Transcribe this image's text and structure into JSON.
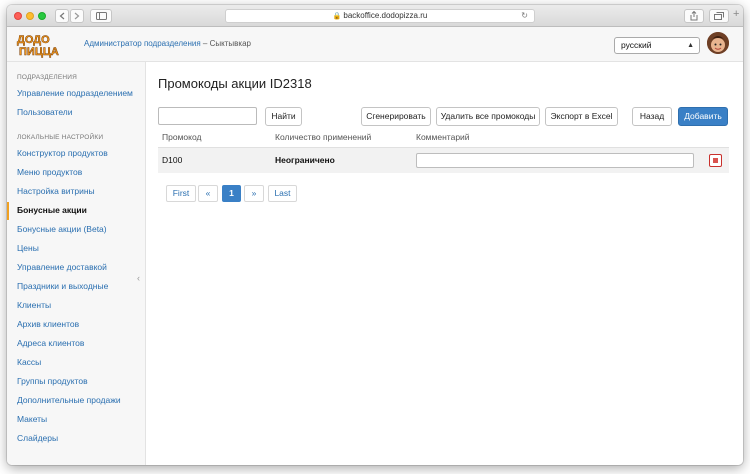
{
  "browser": {
    "url": "backoffice.dodopizza.ru",
    "new_tab": "+"
  },
  "header": {
    "logo_alt": "ДОДО ПИЦЦА",
    "role": "Администратор подразделения",
    "separator": " – ",
    "city": "Сыктывкар",
    "language": "русский"
  },
  "sidebar": {
    "section1": "ПОДРАЗДЕЛЕНИЯ",
    "items1": [
      "Управление подразделением",
      "Пользователи"
    ],
    "section2": "ЛОКАЛЬНЫЕ НАСТРОЙКИ",
    "items2": [
      "Конструктор продуктов",
      "Меню продуктов",
      "Настройка витрины",
      "Бонусные акции",
      "Бонусные акции (Beta)",
      "Цены",
      "Управление доставкой",
      "Праздники и выходные",
      "Клиенты",
      "Архив клиентов",
      "Адреса клиентов",
      "Кассы",
      "Группы продуктов",
      "Дополнительные продажи",
      "Макеты",
      "Слайдеры"
    ],
    "active_item": "Бонусные акции"
  },
  "main": {
    "title": "Промокоды акции ID2318",
    "search": {
      "value": "",
      "placeholder": ""
    },
    "buttons": {
      "find": "Найти",
      "generate": "Сгенерировать",
      "delete_all": "Удалить все промокоды",
      "export": "Экспорт в Excel",
      "back": "Назад",
      "add": "Добавить"
    },
    "table": {
      "columns": [
        "Промокод",
        "Количество применений",
        "Комментарий"
      ],
      "rows": [
        {
          "code": "D100",
          "uses": "Неограничено",
          "comment": ""
        }
      ]
    },
    "pagination": {
      "first": "First",
      "prev": "«",
      "current": "1",
      "next": "»",
      "last": "Last"
    }
  },
  "colors": {
    "primary": "#3a80c6",
    "link": "#2a6fb0",
    "danger": "#d9534f",
    "active_marker": "#f0a020"
  }
}
